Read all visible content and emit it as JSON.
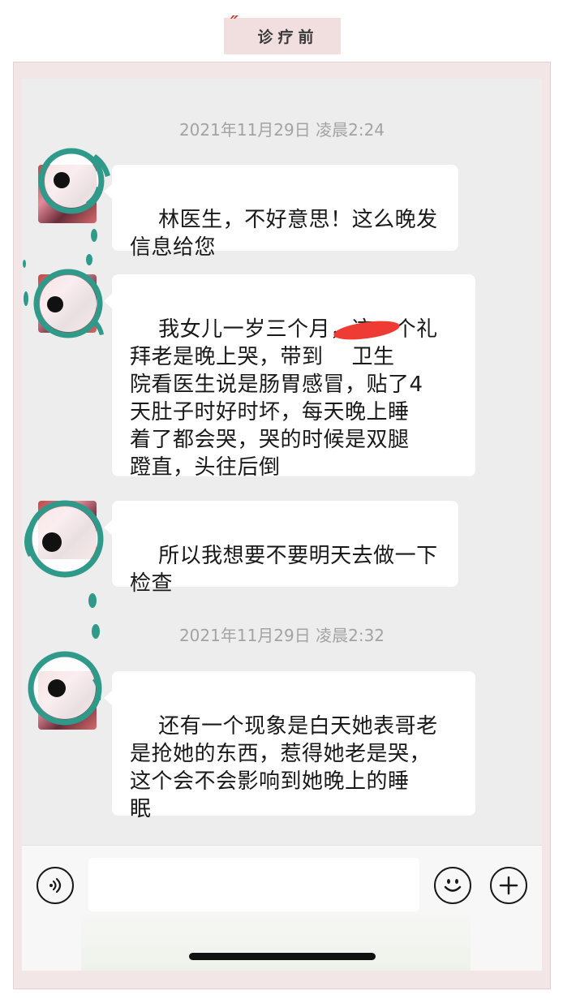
{
  "header": {
    "title": "诊疗前"
  },
  "chat": {
    "timestamps": [
      "2021年11月29日 凌晨2:24",
      "2021年11月29日 凌晨2:32"
    ],
    "messages": [
      {
        "text": "林医生，不好意思！这么晚发\n信息给您"
      },
      {
        "text": "我女儿一岁三个月，这一个礼\n拜老是晚上哭，带到    卫生\n院看医生说是肠胃感冒，贴了4\n天肚子时好时坏，每天晚上睡\n着了都会哭，哭的时候是双腿\n蹬直，头往后倒"
      },
      {
        "text": "所以我想要不要明天去做一下\n检查"
      },
      {
        "text": "还有一个现象是白天她表哥老\n是抢她的东西，惹得她老是哭，\n这个会不会影响到她晚上的睡\n眠"
      }
    ]
  },
  "input_bar": {
    "voice_icon": "voice-icon",
    "emoji_icon": "emoji-icon",
    "plus_icon": "plus-icon",
    "input_value": ""
  },
  "colors": {
    "frame": "#f3e6e6",
    "chat_bg": "#ededed",
    "decoration_teal": "#2f9a8a",
    "redaction": "#ee3b33"
  }
}
